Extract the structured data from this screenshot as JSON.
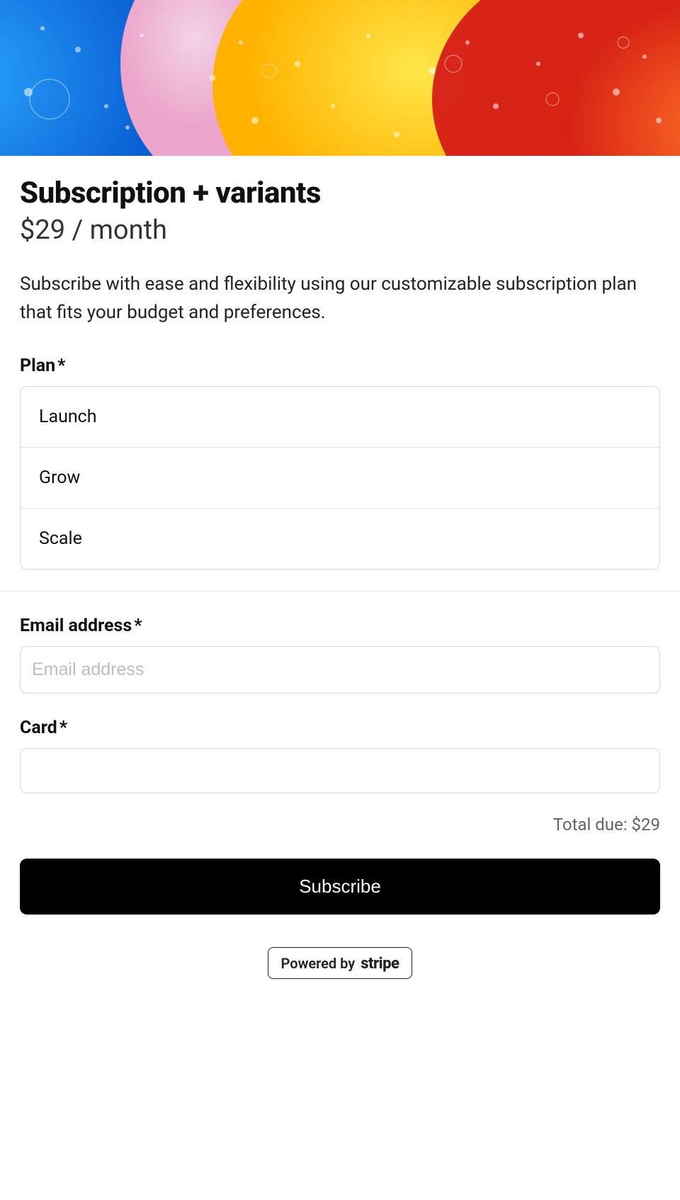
{
  "hero": {
    "alt": "colorful-abstract-bubbles"
  },
  "header": {
    "title": "Subscription + variants",
    "price": "$29 / month"
  },
  "description": "Subscribe with ease and flexibility using our customizable subscription plan that fits your budget and preferences.",
  "plan": {
    "label": "Plan",
    "required_mark": "*",
    "options": [
      "Launch",
      "Grow",
      "Scale"
    ]
  },
  "email": {
    "label": "Email address",
    "required_mark": "*",
    "placeholder": "Email address",
    "value": ""
  },
  "card": {
    "label": "Card",
    "required_mark": "*"
  },
  "total": {
    "label": "Total due:",
    "amount": "$29"
  },
  "submit_label": "Subscribe",
  "powered": {
    "prefix": "Powered by",
    "brand": "stripe"
  }
}
